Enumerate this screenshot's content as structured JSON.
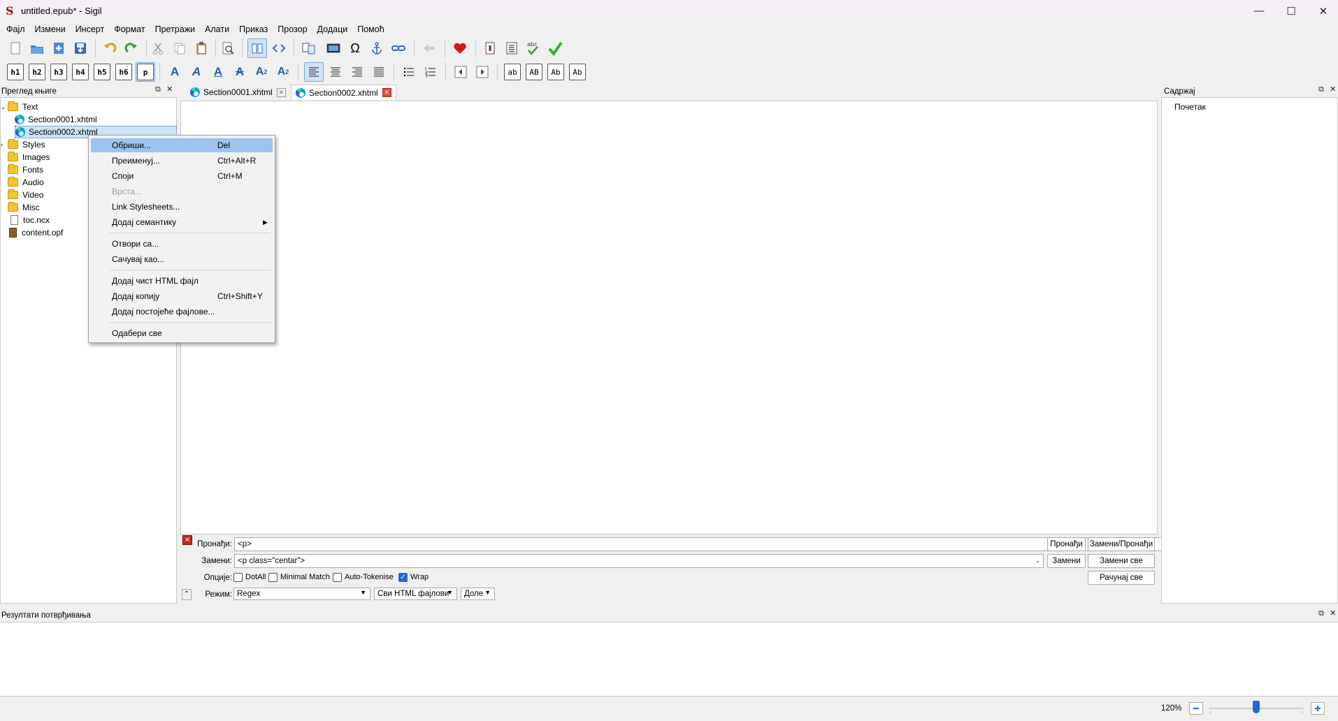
{
  "window": {
    "title": "untitled.epub* - Sigil",
    "minimize": "—",
    "maximize": "☐",
    "close": "✕"
  },
  "menubar": [
    "Фајл",
    "Измени",
    "Инсерт",
    "Формат",
    "Претражи",
    "Алати",
    "Приказ",
    "Прозор",
    "Додаци",
    "Помоћ"
  ],
  "toolbar2": {
    "headings": [
      "h1",
      "h2",
      "h3",
      "h4",
      "h5",
      "h6",
      "p"
    ],
    "case_buttons": [
      "ab",
      "AB",
      "Ab",
      "Ab"
    ]
  },
  "book_browser": {
    "title": "Преглед књиге",
    "items": [
      {
        "label": "Text",
        "type": "folder"
      },
      {
        "label": "Section0001.xhtml",
        "type": "xhtml"
      },
      {
        "label": "Section0002.xhtml",
        "type": "xhtml",
        "selected": true
      },
      {
        "label": "Styles",
        "type": "folder"
      },
      {
        "label": "Images",
        "type": "folder"
      },
      {
        "label": "Fonts",
        "type": "folder"
      },
      {
        "label": "Audio",
        "type": "folder"
      },
      {
        "label": "Video",
        "type": "folder"
      },
      {
        "label": "Misc",
        "type": "folder"
      },
      {
        "label": "toc.ncx",
        "type": "file"
      },
      {
        "label": "content.opf",
        "type": "opf"
      }
    ]
  },
  "tabs": [
    {
      "label": "Section0001.xhtml",
      "selected": false
    },
    {
      "label": "Section0002.xhtml",
      "selected": true
    }
  ],
  "context_menu": {
    "items": [
      {
        "label": "Обриши...",
        "shortcut": "Del",
        "highlighted": true
      },
      {
        "label": "Преименуј...",
        "shortcut": "Ctrl+Alt+R"
      },
      {
        "label": "Споји",
        "shortcut": "Ctrl+M"
      },
      {
        "label": "Врста...",
        "shortcut": "",
        "disabled": true
      },
      {
        "label": "Link Stylesheets...",
        "shortcut": ""
      },
      {
        "label": "Додај семантику",
        "shortcut": "",
        "submenu": true
      },
      {
        "label": "Отвори са...",
        "shortcut": ""
      },
      {
        "label": "Сачувај као...",
        "shortcut": ""
      },
      {
        "label": "Додај чист HTML фајл",
        "shortcut": ""
      },
      {
        "label": "Додај копију",
        "shortcut": "Ctrl+Shift+Y"
      },
      {
        "label": "Додај постојеће фајлове...",
        "shortcut": ""
      },
      {
        "label": "Одабери све",
        "shortcut": ""
      }
    ]
  },
  "find_replace": {
    "find_label": "Пронађи:",
    "find_value": "<p>",
    "replace_label": "Замени:",
    "replace_value": "<p class=\"centar\">",
    "options_label": "Опције:",
    "options": [
      {
        "label": "DotAll",
        "checked": false
      },
      {
        "label": "Minimal Match",
        "checked": false
      },
      {
        "label": "Auto-Tokenise",
        "checked": false
      },
      {
        "label": "Wrap",
        "checked": true
      }
    ],
    "mode_label": "Режим:",
    "mode_value": "Regex",
    "scope_value": "Сви HTML фајлови",
    "direction_value": "Доле",
    "buttons": {
      "find": "Пронађи",
      "replace_find": "Замени/Пронађи",
      "replace": "Замени",
      "replace_all": "Замени све",
      "count_all": "Рачунај све"
    }
  },
  "toc_panel": {
    "title": "Садржај",
    "items": [
      "Почетак"
    ]
  },
  "validation_panel": {
    "title": "Резултати потврђивања"
  },
  "status": {
    "zoom": "120%",
    "zoom_fraction": 0.5
  },
  "colors": {
    "accent": "#1f6ad6",
    "menu_highlight": "#9bc4ef",
    "close_red": "#e04a3a"
  }
}
